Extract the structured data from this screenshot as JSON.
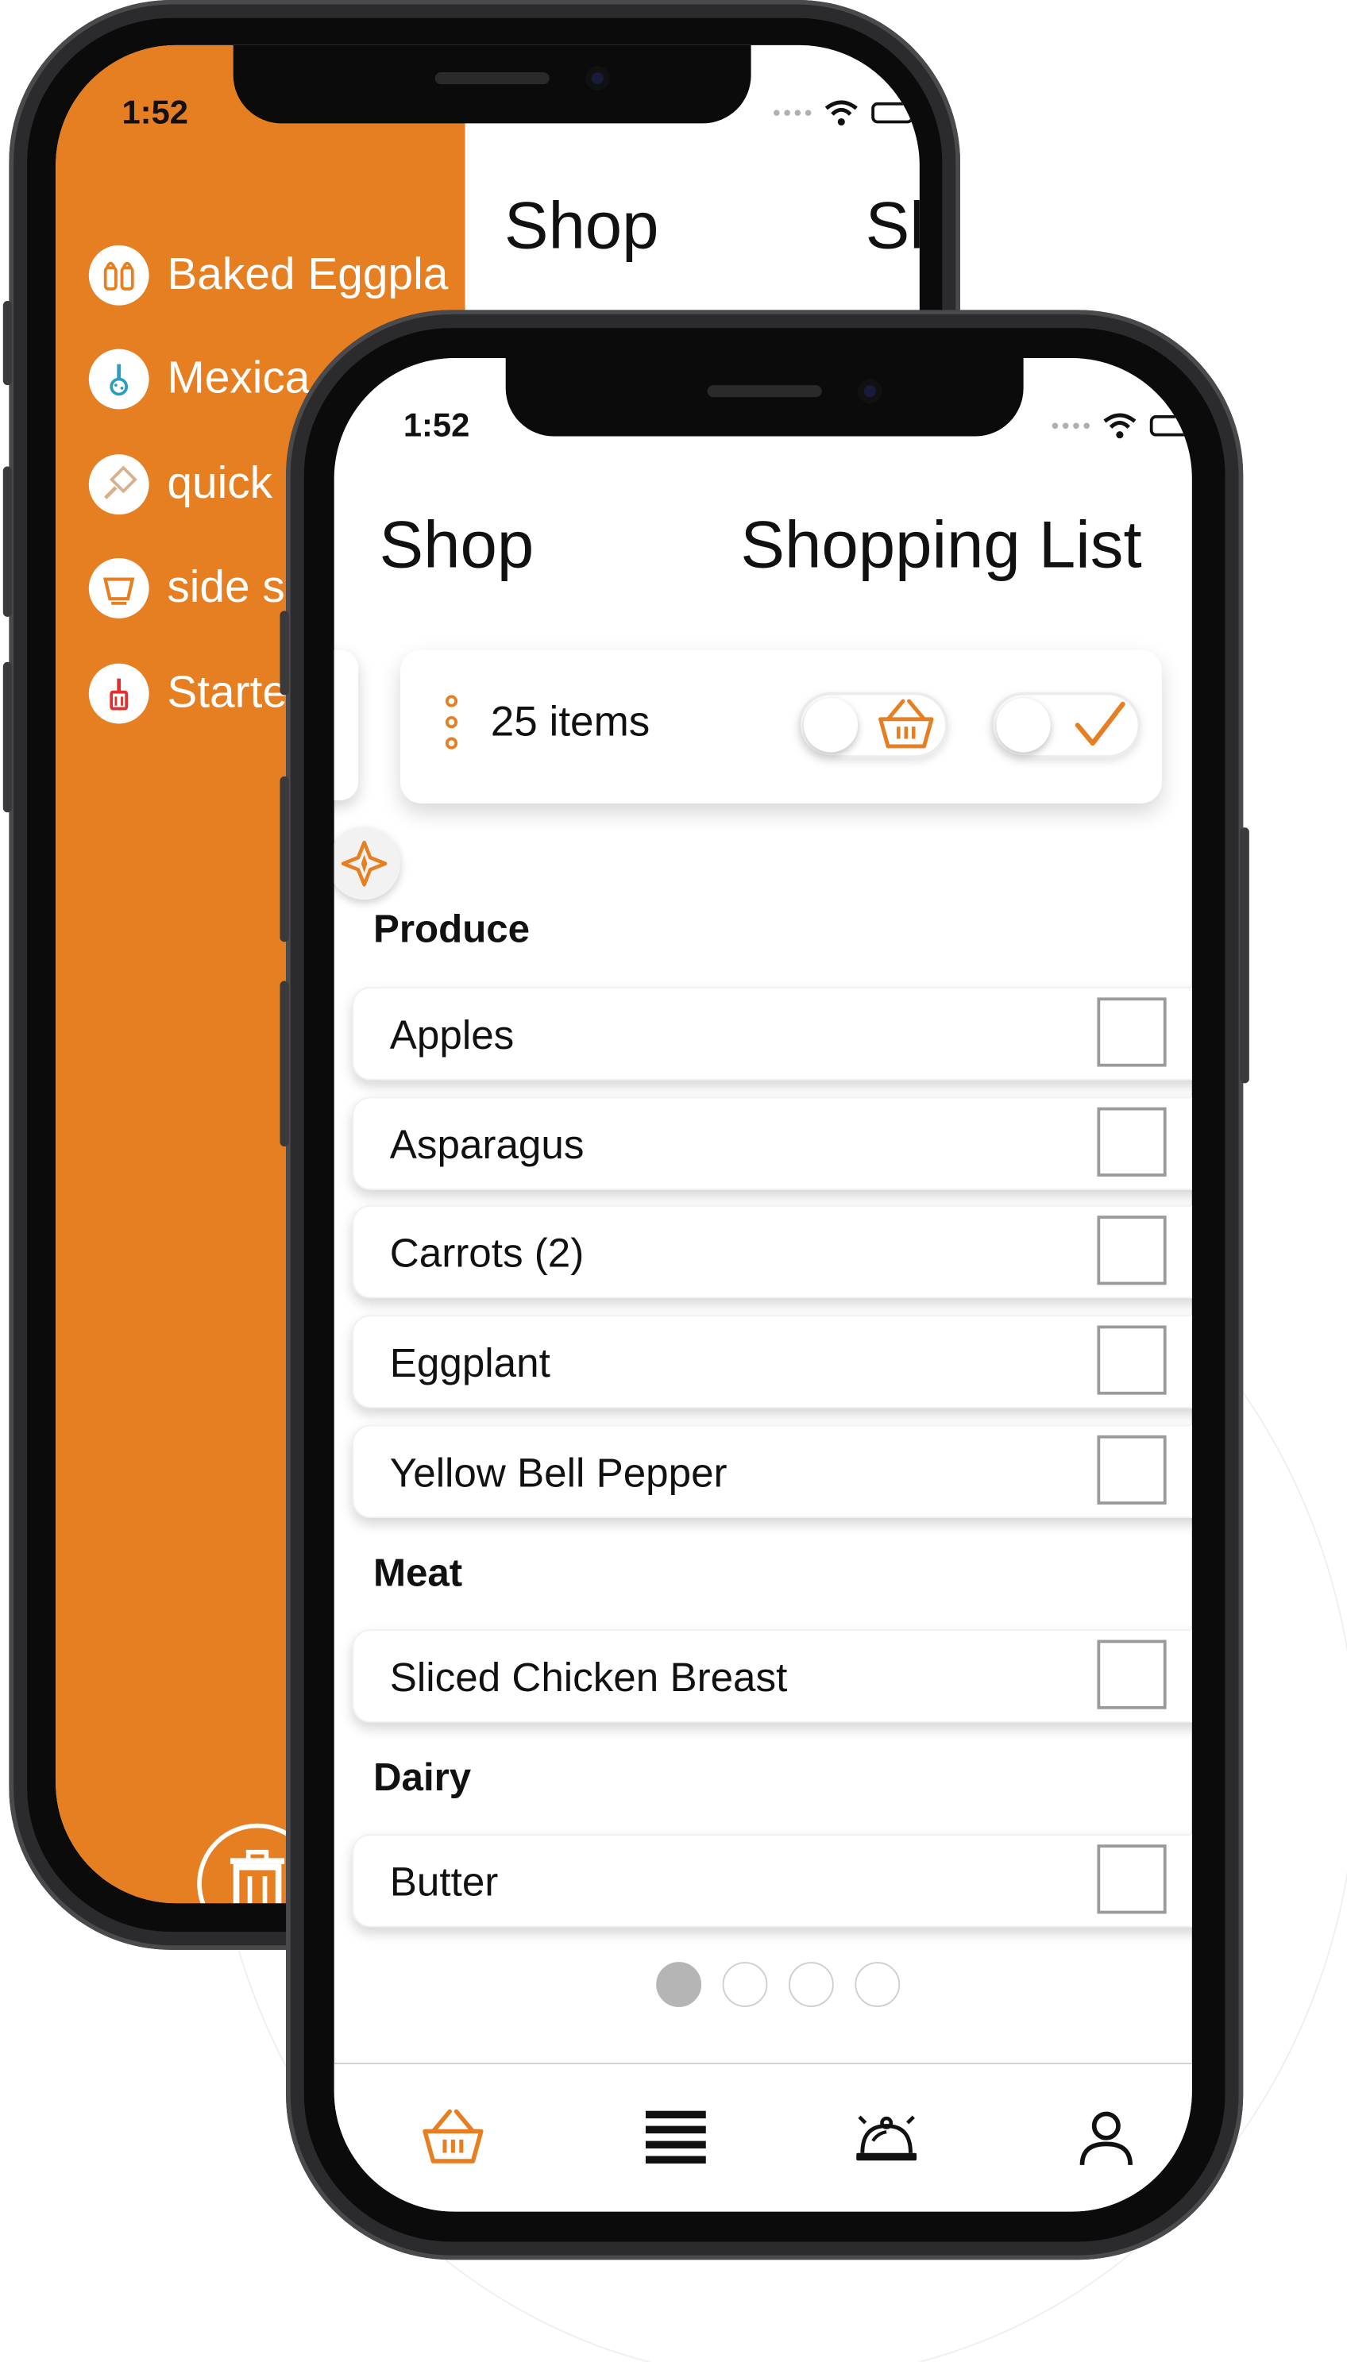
{
  "colors": {
    "accent": "#e67e22",
    "text": "#111111",
    "check_border": "#9a9a9a",
    "pager_active": "#b5b5b5"
  },
  "back_screen": {
    "time": "1:52",
    "drawer_items": [
      {
        "label": "Baked Eggpla",
        "icon": "salt-pepper-icon"
      },
      {
        "label": "Mexica",
        "icon": "whisk-icon"
      },
      {
        "label": "quick",
        "icon": "grater-icon"
      },
      {
        "label": "side s",
        "icon": "bowl-icon"
      },
      {
        "label": "Starte",
        "icon": "spatula-icon"
      }
    ],
    "header_left": "Shop",
    "header_right": "Sl",
    "trash_icon": "trash-icon"
  },
  "front_screen": {
    "time": "1:52",
    "title_left": "Shop",
    "title_right": "Shopping List",
    "summary": {
      "count_label": "25 items",
      "toggle_basket_icon": "basket-icon",
      "toggle_check_icon": "checkmark-icon"
    },
    "sections": [
      {
        "title": "Produce",
        "items": [
          "Apples",
          "Asparagus",
          "Carrots (2)",
          "Eggplant",
          "Yellow Bell Pepper"
        ]
      },
      {
        "title": "Meat",
        "items": [
          "Sliced Chicken Breast"
        ]
      },
      {
        "title": "Dairy",
        "items": [
          "Butter"
        ]
      }
    ],
    "pager": {
      "pages": 4,
      "active": 1
    },
    "tabs": [
      {
        "name": "shop",
        "icon": "basket-icon",
        "active": true
      },
      {
        "name": "list",
        "icon": "menu-lines-icon",
        "active": false
      },
      {
        "name": "recipes",
        "icon": "cloche-icon",
        "active": false
      },
      {
        "name": "profile",
        "icon": "user-icon",
        "active": false
      }
    ]
  }
}
